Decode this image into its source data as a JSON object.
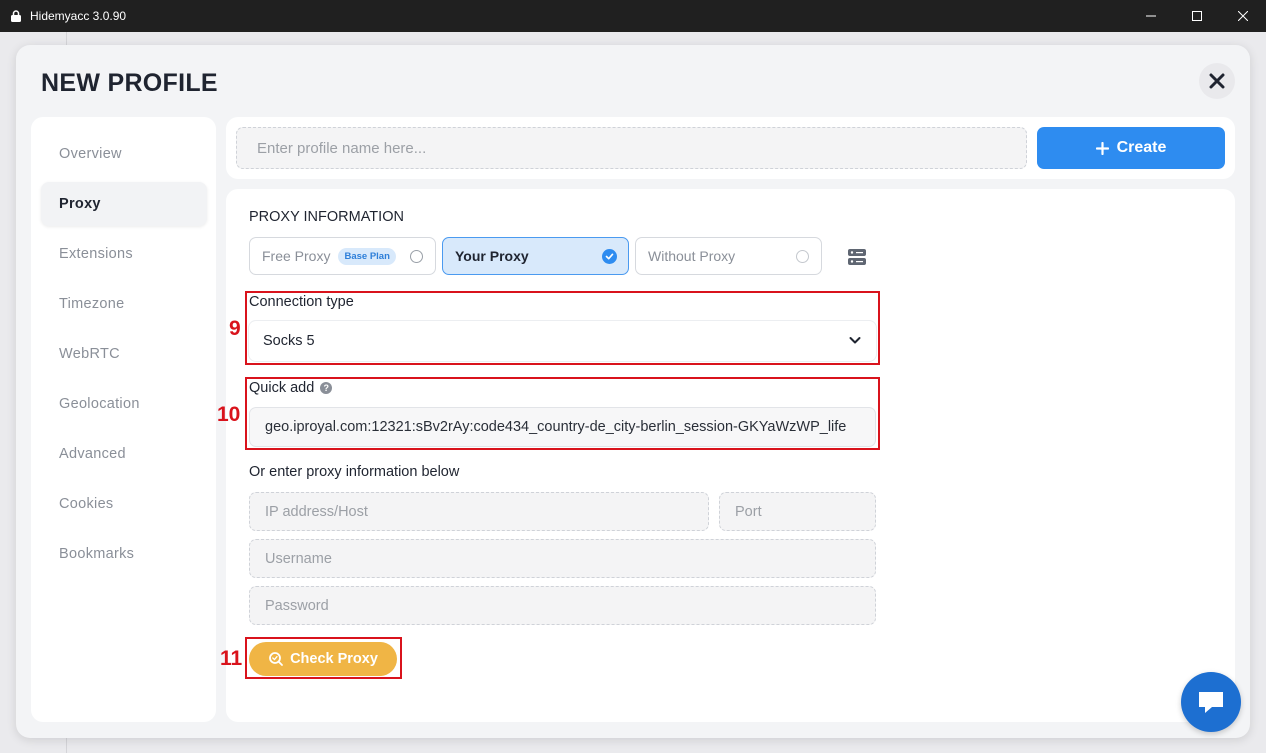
{
  "window": {
    "title": "Hidemyacc 3.0.90"
  },
  "modal": {
    "title": "NEW PROFILE"
  },
  "sidebar": {
    "items": [
      {
        "label": "Overview",
        "active": false
      },
      {
        "label": "Proxy",
        "active": true
      },
      {
        "label": "Extensions",
        "active": false
      },
      {
        "label": "Timezone",
        "active": false
      },
      {
        "label": "WebRTC",
        "active": false
      },
      {
        "label": "Geolocation",
        "active": false
      },
      {
        "label": "Advanced",
        "active": false
      },
      {
        "label": "Cookies",
        "active": false
      },
      {
        "label": "Bookmarks",
        "active": false
      }
    ]
  },
  "topbar": {
    "name_placeholder": "Enter profile name here...",
    "create_label": "Create"
  },
  "proxy": {
    "section_title": "PROXY INFORMATION",
    "tabs": [
      {
        "label": "Free Proxy",
        "badge": "Base Plan",
        "selected": false
      },
      {
        "label": "Your Proxy",
        "selected": true
      },
      {
        "label": "Without Proxy",
        "selected": false
      }
    ],
    "connection_type_label": "Connection type",
    "connection_type_value": "Socks 5",
    "quick_add_label": "Quick add",
    "quick_add_value": "geo.iproyal.com:12321:sBv2rAy:code434_country-de_city-berlin_session-GKYaWzWP_life",
    "manual_label": "Or enter proxy information below",
    "ip_placeholder": "IP address/Host",
    "port_placeholder": "Port",
    "username_placeholder": "Username",
    "password_placeholder": "Password",
    "check_label": "Check Proxy"
  },
  "annotations": {
    "connection_type": "9",
    "quick_add": "10",
    "check_proxy": "11"
  },
  "colors": {
    "accent": "#2e8cf0",
    "check_button": "#f0b545",
    "annotation": "#d9131c",
    "titlebar": "#202020",
    "chat": "#1d6fd1"
  }
}
